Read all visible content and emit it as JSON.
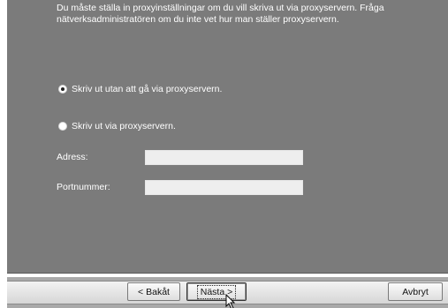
{
  "intro": {
    "line1": "Du måste ställa in proxyinställningar om du vill skriva ut via proxyservern. Fråga",
    "line2": "nätverksadministratören om du inte vet hur man ställer proxyservern."
  },
  "options": [
    {
      "label": "Skriv ut utan att gå via proxyservern.",
      "selected": true
    },
    {
      "label": "Skriv ut via proxyservern.",
      "selected": false
    }
  ],
  "fields": {
    "address": {
      "label": "Adress:",
      "value": ""
    },
    "port": {
      "label": "Portnummer:",
      "value": ""
    }
  },
  "buttons": {
    "back": "< Bakåt",
    "next": "Nästa >",
    "cancel": "Avbryt"
  },
  "colors": {
    "panel": "#7b7b7b",
    "text": "#ffffff",
    "field": "#eeeeee"
  },
  "icons": {
    "cursor": "arrow-pointer-icon"
  }
}
